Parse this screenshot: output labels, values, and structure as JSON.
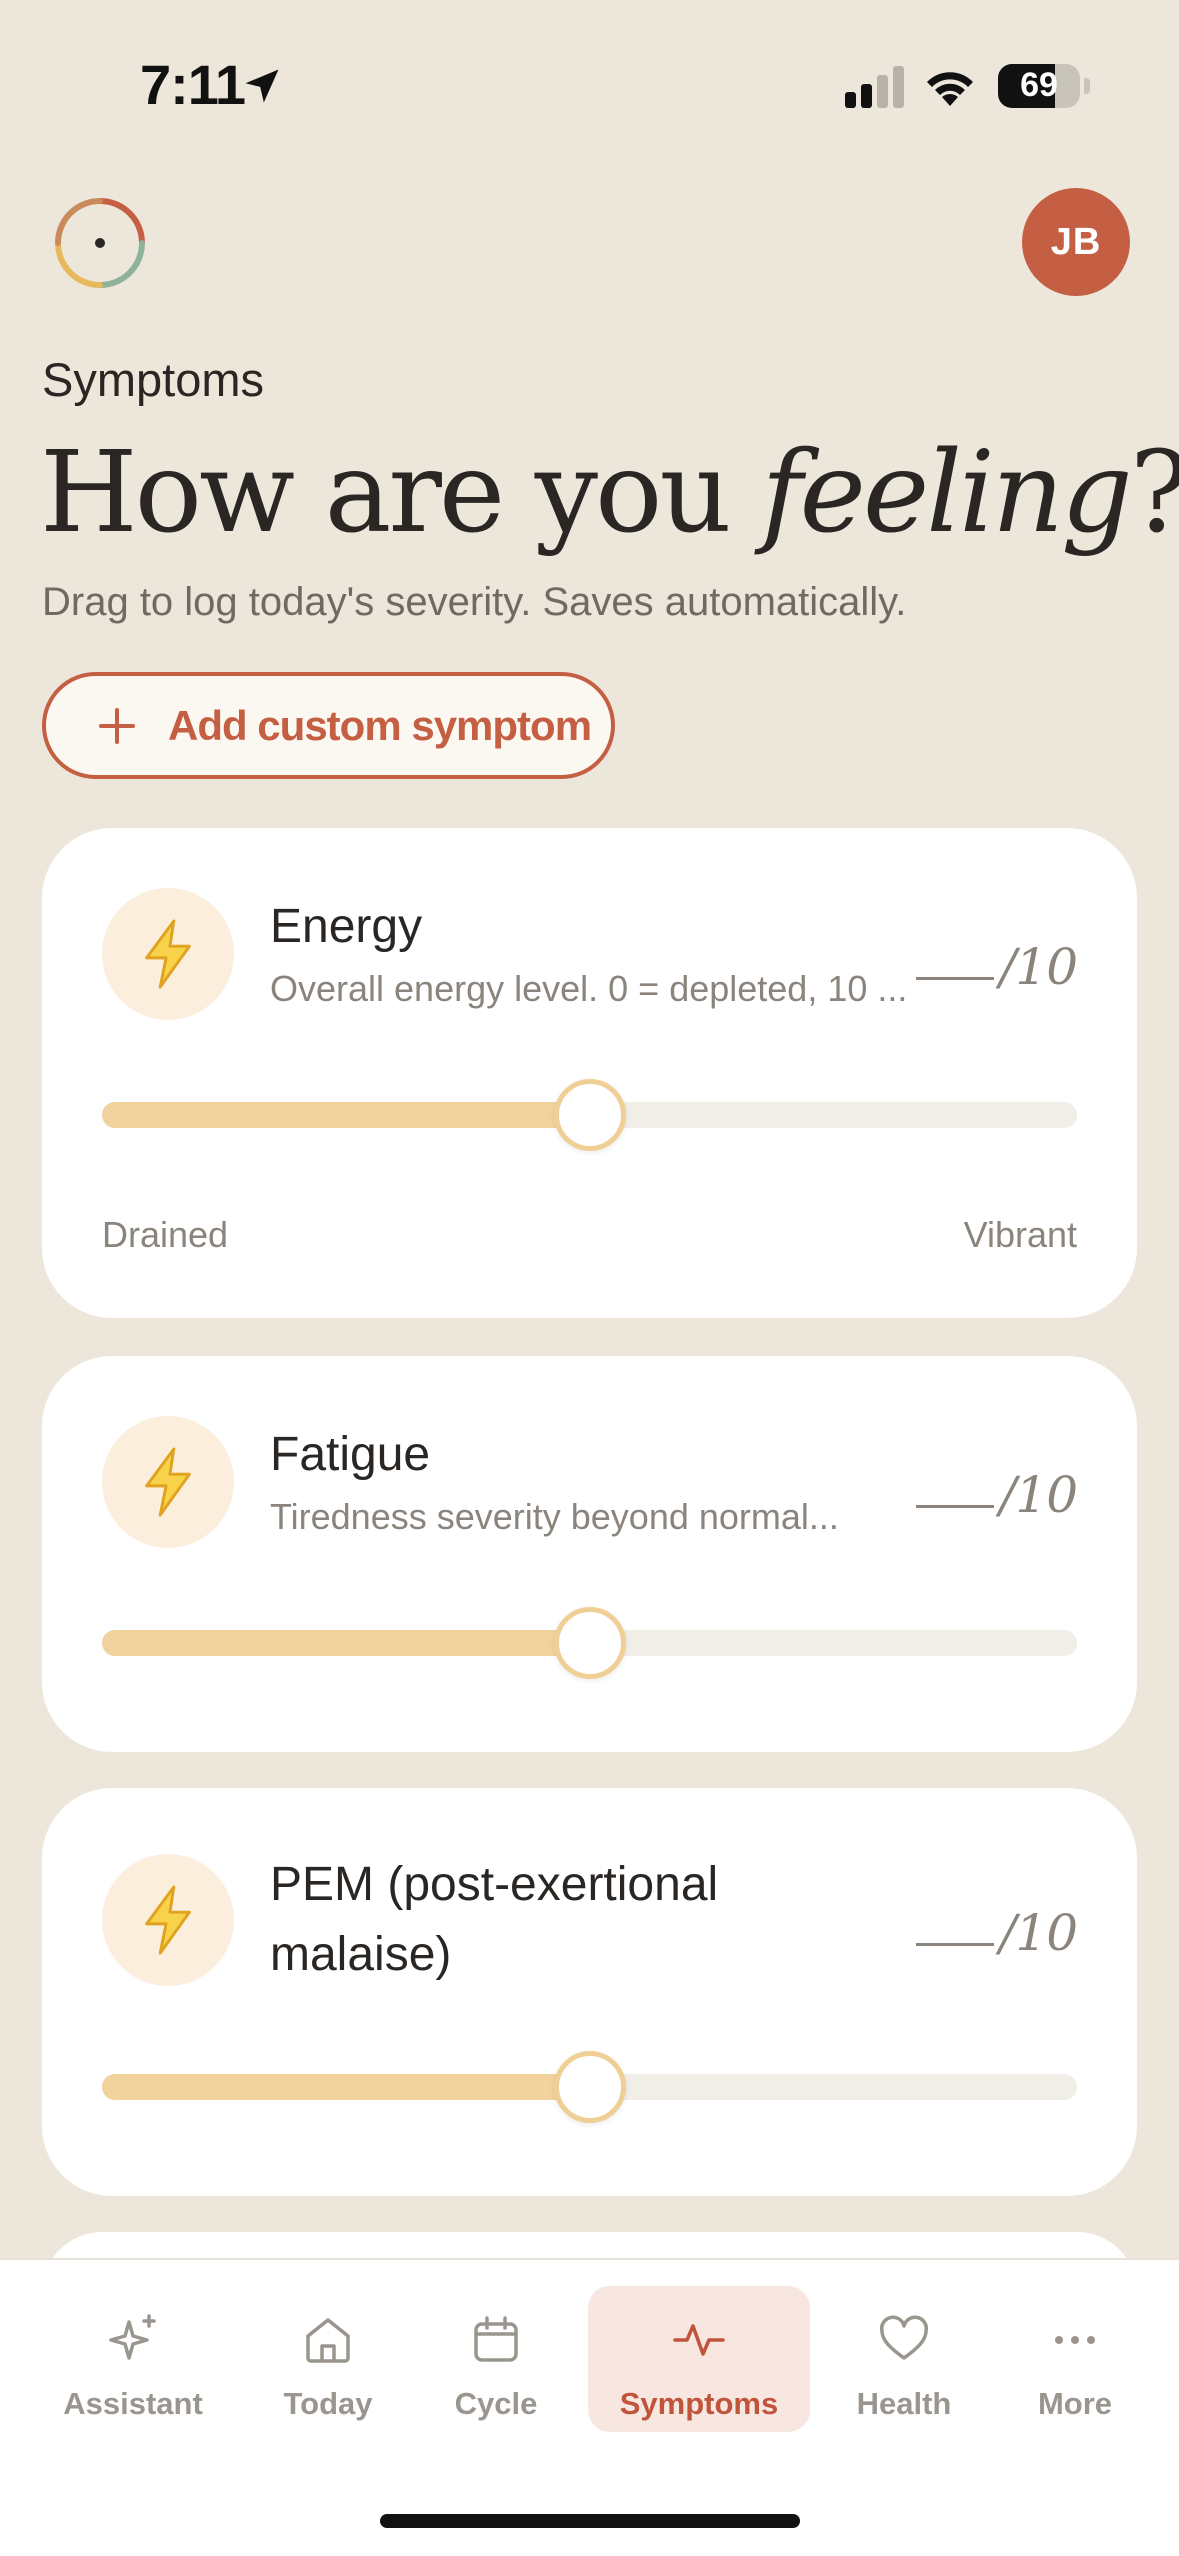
{
  "status_bar": {
    "time": "7:11",
    "battery": "69",
    "battery_level_percent": 69
  },
  "header": {
    "avatar_initials": "JB",
    "section_label": "Symptoms",
    "headline_plain": "How are you ",
    "headline_italic": "feeling",
    "headline_end": "?",
    "subtitle": "Drag to log today's severity. Saves automatically."
  },
  "add_button": {
    "label": "Add custom symptom",
    "icon": "plus-icon"
  },
  "symptoms": [
    {
      "title": "Energy",
      "description": "Overall energy level. 0 = depleted, 10 ...",
      "score_max": "/10",
      "slider_value": 5,
      "slider_max": 10,
      "range_min_label": "Drained",
      "range_max_label": "Vibrant",
      "icon": "lightning-icon"
    },
    {
      "title": "Fatigue",
      "description": "Tiredness severity beyond normal...",
      "score_max": "/10",
      "slider_value": 5,
      "slider_max": 10,
      "icon": "lightning-icon"
    },
    {
      "title": "PEM (post-exertional malaise)",
      "description": "",
      "score_max": "/10",
      "slider_value": 5,
      "slider_max": 10,
      "icon": "lightning-icon"
    }
  ],
  "tab_bar": {
    "active": "Symptoms",
    "tabs": [
      {
        "label": "Assistant",
        "icon": "sparkle-icon"
      },
      {
        "label": "Today",
        "icon": "home-icon"
      },
      {
        "label": "Cycle",
        "icon": "calendar-icon"
      },
      {
        "label": "Symptoms",
        "icon": "activity-icon"
      },
      {
        "label": "Health",
        "icon": "heart-icon"
      },
      {
        "label": "More",
        "icon": "more-icon"
      }
    ]
  },
  "colors": {
    "background": "#EDE7DB",
    "accent": "#C55F44",
    "slider_fill": "#F2D29D",
    "icon_bg": "#FBEEDD",
    "active_tab_bg": "#F8E6E1"
  }
}
